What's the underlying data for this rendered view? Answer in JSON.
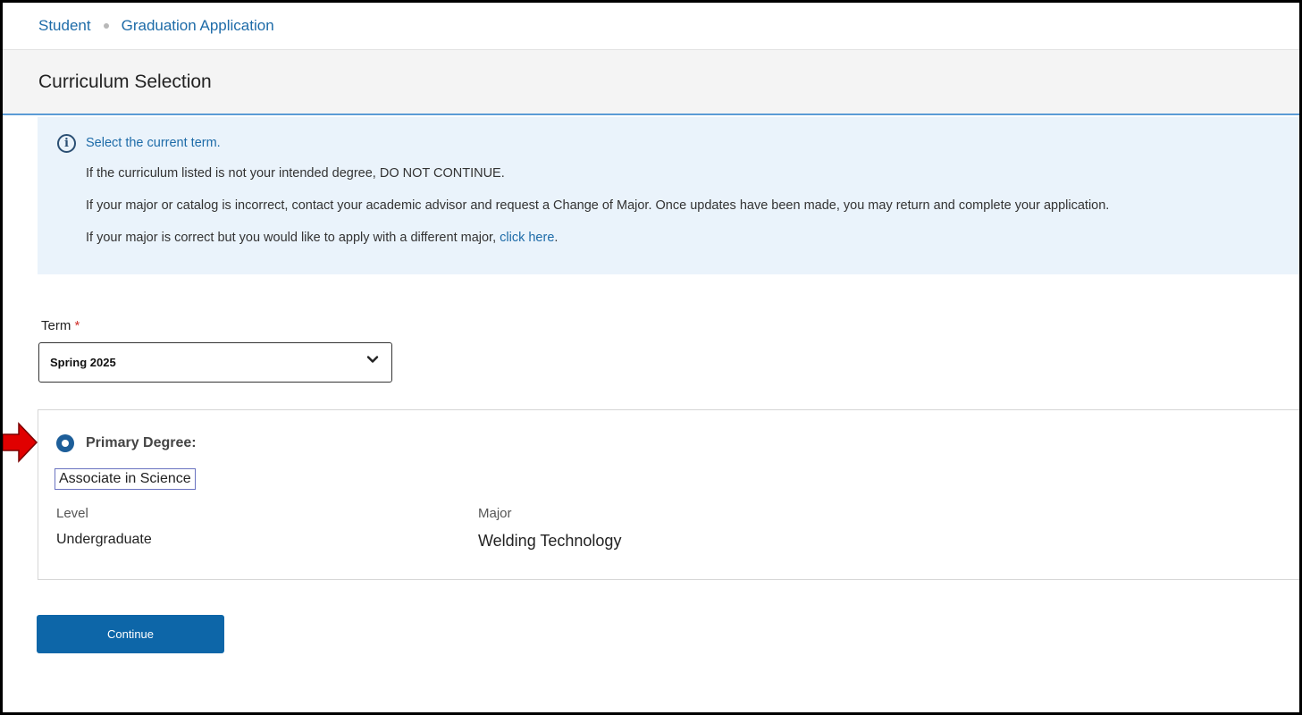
{
  "breadcrumb": {
    "items": [
      "Student",
      "Graduation Application"
    ]
  },
  "header": {
    "title": "Curriculum Selection"
  },
  "info": {
    "icon": "info-icon",
    "line1": "Select the current term.",
    "line2": "If the curriculum listed is not your intended degree, DO NOT CONTINUE.",
    "line3": "If your major or catalog is incorrect, contact your academic advisor and request a Change of Major. Once updates have been made, you may return and complete your application.",
    "line4_prefix": "If your major is correct but you would like to apply with a different major, ",
    "line4_link": "click here",
    "line4_suffix": "."
  },
  "term": {
    "label": "Term",
    "required_mark": "*",
    "selected": "Spring 2025"
  },
  "degree": {
    "title": "Primary Degree:",
    "name": "Associate in Science",
    "selected": true,
    "level_label": "Level",
    "level_value": "Undergraduate",
    "major_label": "Major",
    "major_value": "Welding Technology"
  },
  "actions": {
    "continue_label": "Continue"
  },
  "colors": {
    "accent": "#0d66a8",
    "link": "#1d6ba8",
    "info_bg": "#eaf3fb",
    "arrow": "#e00000"
  }
}
